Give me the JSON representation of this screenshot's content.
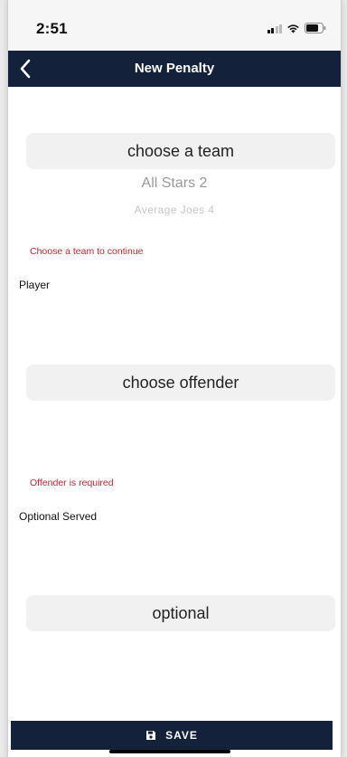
{
  "status_bar": {
    "time": "2:51"
  },
  "nav": {
    "title": "New Penalty",
    "back_icon": "chevron-left-icon"
  },
  "team_picker": {
    "label": "choose a team",
    "options": [
      "All Stars 2",
      "Average Joes 4"
    ],
    "error": "Choose a team to continue"
  },
  "player": {
    "label": "Player",
    "picker_label": "choose offender",
    "error": "Offender is required"
  },
  "optional_served": {
    "label": "Optional Served",
    "picker_label": "optional"
  },
  "save_button": {
    "label": "SAVE",
    "icon": "floppy-disk-icon"
  },
  "colors": {
    "nav_background": "#13213a",
    "error": "#c82333",
    "picker_background": "#f1f1f2"
  }
}
